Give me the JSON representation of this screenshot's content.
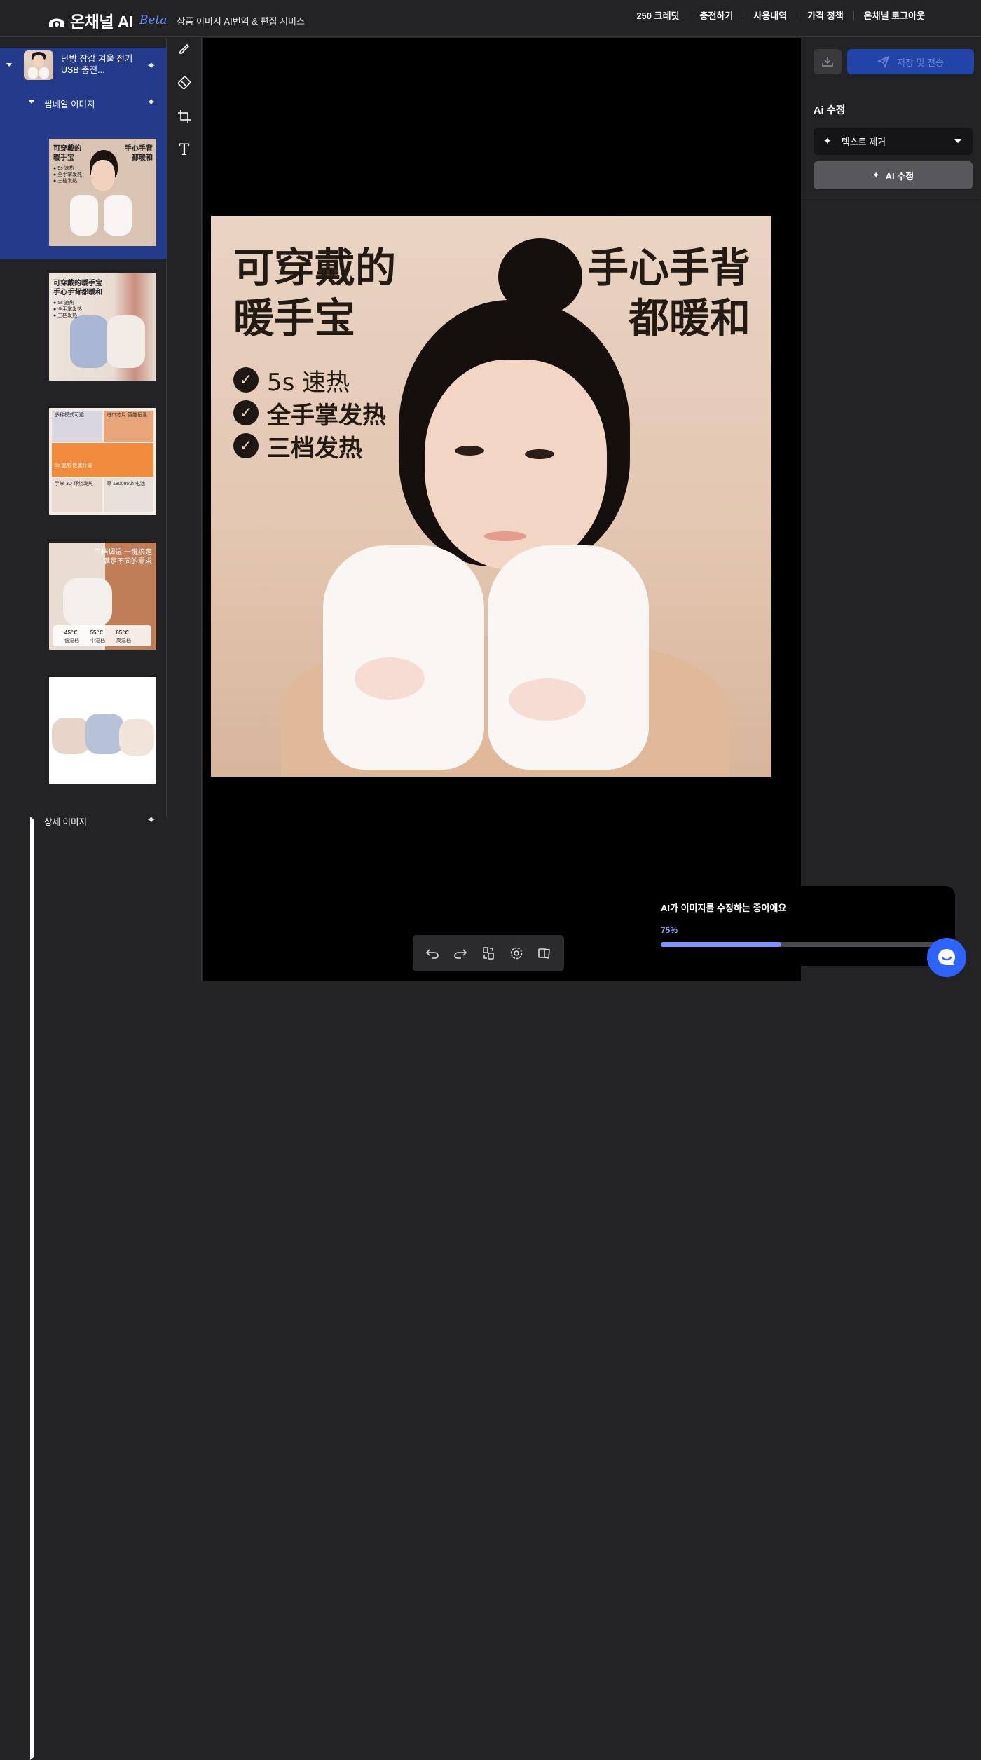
{
  "header": {
    "brand": "온채널 AI",
    "beta": "Beta",
    "tagline": "상품 이미지 AI번역 & 편집 서비스",
    "nav": [
      "250 크레딧",
      "충전하기",
      "사용내역",
      "가격 정책",
      "온채널 로그아웃"
    ]
  },
  "sidebar": {
    "product_title": "난방 장갑 겨울 전기 USB 충전...",
    "section_thumbnails": "썸네일 이미지",
    "section_details": "상세 이미지",
    "thumbnails": [
      {
        "lines": [
          "可穿戴的",
          "暖手宝"
        ],
        "lines_right": [
          "手心手背",
          "都暖和"
        ],
        "bullets": [
          "5s 速热",
          "全手掌发热",
          "三档发热"
        ],
        "selected": true
      },
      {
        "lines": [
          "可穿戴的暖手宝",
          "手心手背都暖和"
        ],
        "bullets": [
          "5s 速热",
          "全手掌发热",
          "三档发热"
        ],
        "selected": false
      },
      {
        "captions": [
          "多种模式可选",
          "进口芯片 智能恒温",
          "5s 速热 快速升温",
          "手掌 3D 环绕发热",
          "厚 1800mAh 电池"
        ],
        "selected": false
      },
      {
        "lines": [
          "三档调温 一键搞定",
          "满足不同的需求"
        ],
        "temps": [
          "45℃",
          "55℃",
          "65℃"
        ],
        "levels": [
          "低温档",
          "中温档",
          "高温档"
        ],
        "selected": false
      },
      {
        "selected": false
      }
    ]
  },
  "tools": [
    "brush-icon",
    "eraser-icon",
    "crop-icon",
    "text-tool-icon"
  ],
  "canvas": {
    "text_left": [
      "可穿戴的",
      "暖手宝"
    ],
    "text_right": [
      "手心手背",
      "都暖和"
    ],
    "bullets": [
      "5s 速热",
      "全手掌发热",
      "三档发热"
    ]
  },
  "bottom_toolbar": [
    "undo-icon",
    "redo-icon",
    "compare-icon",
    "settings-icon",
    "pages-icon"
  ],
  "right_panel": {
    "send_label": "저장 및 전송",
    "section_title": "Ai 수정",
    "mode_selected": "텍스트 제거",
    "ai_button": "AI 수정"
  },
  "progress": {
    "message": "AI가 이미지를 수정하는 중이에요",
    "percent_label": "75%",
    "fraction": 0.43
  },
  "colors": {
    "accent": "#2f63ff",
    "selected_bg": "#243a8a",
    "progress": "#7d92ff"
  }
}
